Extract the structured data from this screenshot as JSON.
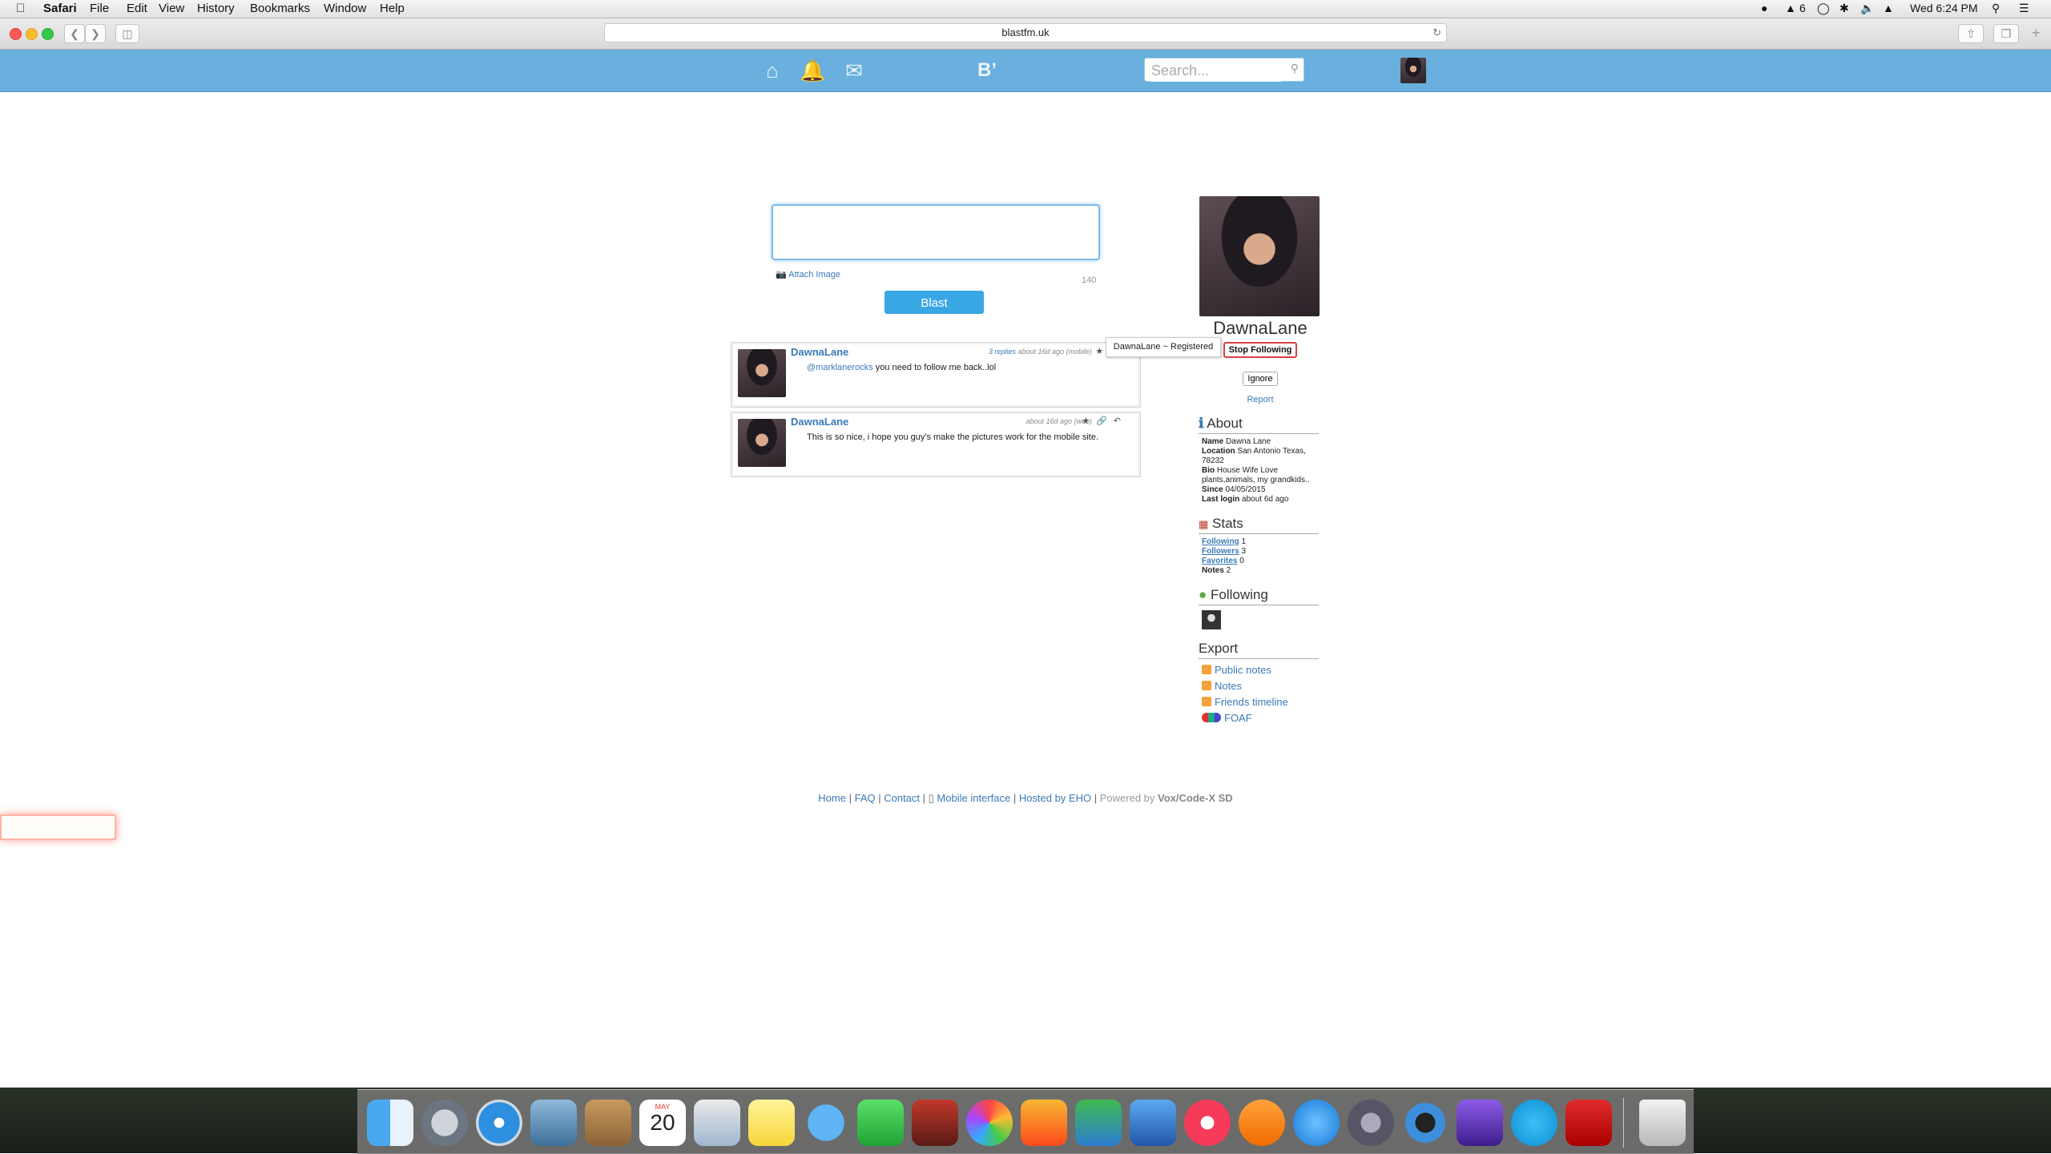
{
  "menubar": {
    "apple": "",
    "app_name": "Safari",
    "items": [
      "File",
      "Edit",
      "View",
      "History",
      "Bookmarks",
      "Window",
      "Help"
    ],
    "status_number": "6",
    "clock": "Wed 6:24 PM"
  },
  "browser": {
    "url": "blastfm.uk"
  },
  "site_header": {
    "search_placeholder": "Search...",
    "icons": [
      "home-icon",
      "notifications-icon",
      "mail-icon",
      "blast-logo-icon"
    ]
  },
  "composer": {
    "attach_label": "Attach Image",
    "char_count": "140",
    "submit_label": "Blast"
  },
  "notices": [
    {
      "author": "DawnaLane",
      "replies": "3 replies",
      "meta": "about 16d ago (mobile)",
      "mention": "@marklanerocks",
      "text": " you need to follow me back..lol"
    },
    {
      "author": "DawnaLane",
      "replies": "",
      "meta": "about 16d ago (web)",
      "mention": "",
      "text": "This is so nice, i hope you guy's make the pictures work for the mobile site."
    }
  ],
  "tooltip": "DawnaLane ~ Registered",
  "profile": {
    "name": "DawnaLane",
    "stop_following": "Stop Following",
    "ignore": "Ignore",
    "report": "Report",
    "about_title": "About",
    "about": {
      "name_label": "Name",
      "name": "Dawna Lane",
      "location_label": "Location",
      "location": "San Antonio Texas, 78232",
      "bio_label": "Bio",
      "bio": "House Wife Love plants,animals, my grandkids..",
      "since_label": "Since",
      "since": "04/05/2015",
      "last_login_label": "Last login",
      "last_login": "about 6d ago"
    },
    "stats_title": "Stats",
    "stats": {
      "following_label": "Following",
      "following": "1",
      "followers_label": "Followers",
      "followers": "3",
      "favorites_label": "Favorites",
      "favorites": "0",
      "notes_label": "Notes",
      "notes": "2"
    },
    "following_title": "Following",
    "export_title": "Export",
    "export_links": [
      "Public notes",
      "Notes",
      "Friends timeline",
      "FOAF"
    ]
  },
  "footer": {
    "home": "Home",
    "faq": "FAQ",
    "contact": "Contact",
    "mobile": "Mobile interface",
    "hosted": "Hosted by EHO",
    "powered_prefix": "Powered by",
    "powered_name": "Vox/Code-X SD"
  },
  "dock": {
    "calendar_month": "MAY",
    "calendar_day": "20"
  },
  "colors": {
    "header_blue": "#6ab0de",
    "link_blue": "#3b7ab8",
    "button_blue": "#3aa7e5",
    "stop_following_border": "#d94040"
  }
}
